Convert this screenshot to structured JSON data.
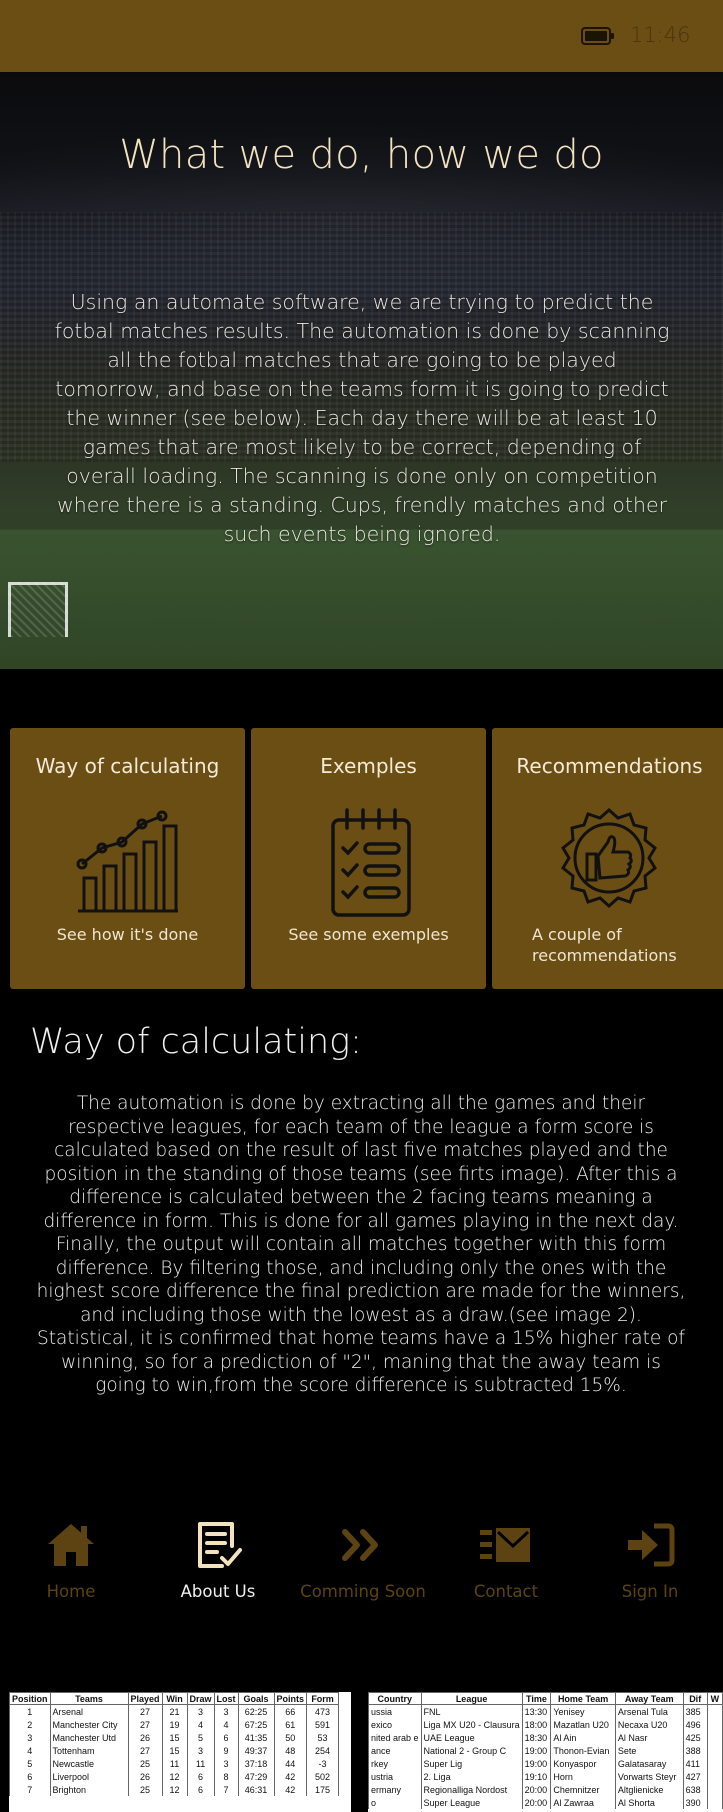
{
  "status_bar": {
    "time": "11:46"
  },
  "hero": {
    "title": "What we do, how we do",
    "text": "Using an automate software, we are trying to predict the fotbal matches results. The automation is done by scanning all the fotbal matches that are going to be played tomorrow, and base on the teams form it is going to predict the winner (see below). Each day there will be at least 10 games that are most likely to be correct, depending of overall loading. The scanning is done only on competition where there is a standing. Cups, frendly matches and other such events being ignored."
  },
  "cards": [
    {
      "title": "Way of calculating",
      "icon": "bar-chart-icon",
      "description": "See how it's done"
    },
    {
      "title": "Exemples",
      "icon": "checklist-icon",
      "description": "See some exemples"
    },
    {
      "title": "Recommendations",
      "icon": "thumbs-up-badge-icon",
      "description": "A couple of recommendations"
    }
  ],
  "calc_section": {
    "title": "Way of calculating:",
    "text": "The automation is done by extracting all the games and their respective leagues, for each team of the league a form score is calculated based on the result of last five matches played and the position in the standing of those teams (see firts image). After this a difference is calculated between the 2 facing teams meaning a difference in form. This is done for all games playing in the next day. Finally, the output will contain all matches together with this form difference. By filtering those, and including only the ones with the highest score difference the final prediction are made for the winners, and including those with the lowest as a draw.(see image 2). Statistical, it is confirmed that home teams have a 15% higher rate of winning, so for a prediction of \"2\", maning that the away team is going to win,from the score difference is subtracted 15%."
  },
  "standings_table": {
    "headers": [
      "Position",
      "Teams",
      "Played",
      "Win",
      "Draw",
      "Lost",
      "Goals",
      "Points",
      "Form"
    ],
    "rows": [
      [
        "1",
        "Arsenal",
        "27",
        "21",
        "3",
        "3",
        "62:25",
        "66",
        "473"
      ],
      [
        "2",
        "Manchester City",
        "27",
        "19",
        "4",
        "4",
        "67:25",
        "61",
        "591"
      ],
      [
        "3",
        "Manchester Utd",
        "26",
        "15",
        "5",
        "6",
        "41:35",
        "50",
        "53"
      ],
      [
        "4",
        "Tottenham",
        "27",
        "15",
        "3",
        "9",
        "49:37",
        "48",
        "254"
      ],
      [
        "5",
        "Newcastle",
        "25",
        "11",
        "11",
        "3",
        "37:18",
        "44",
        "-3"
      ],
      [
        "6",
        "Liverpool",
        "26",
        "12",
        "6",
        "8",
        "47:29",
        "42",
        "502"
      ],
      [
        "7",
        "Brighton",
        "25",
        "12",
        "6",
        "7",
        "46:31",
        "42",
        "175"
      ]
    ]
  },
  "predictions_table": {
    "headers": [
      "Country",
      "League",
      "Time",
      "Home Team",
      "Away Team",
      "Dif",
      "W"
    ],
    "rows": [
      [
        "ussia",
        "FNL",
        "13:30",
        "Yenisey",
        "Arsenal Tula",
        "385",
        ""
      ],
      [
        "exico",
        "Liga MX U20 - Clausura",
        "18:00",
        "Mazatlan U20",
        "Necaxa U20",
        "496",
        ""
      ],
      [
        "nited arab e",
        "UAE League",
        "18:30",
        "Al Ain",
        "Al Nasr",
        "425",
        ""
      ],
      [
        "ance",
        "National 2 - Group C",
        "19:00",
        "Thonon-Evian",
        "Sete",
        "388",
        ""
      ],
      [
        "rkey",
        "Super Lig",
        "19:00",
        "Konyaspor",
        "Galatasaray",
        "411",
        ""
      ],
      [
        "ustria",
        "2. Liga",
        "19:10",
        "Horn",
        "Vorwarts Steyr",
        "427",
        ""
      ],
      [
        "ermany",
        "Regionalliga Nordost",
        "20:00",
        "Chemnitzer",
        "Altglienicke",
        "638",
        ""
      ],
      [
        "o",
        "Super League",
        "20:00",
        "Al Zawraa",
        "Al Shorta",
        "390",
        ""
      ]
    ]
  },
  "nav": [
    {
      "label": "Home",
      "icon": "home-icon",
      "active": false
    },
    {
      "label": "About Us",
      "icon": "document-check-icon",
      "active": true
    },
    {
      "label": "Comming Soon",
      "icon": "double-chevron-right-icon",
      "active": false
    },
    {
      "label": "Contact",
      "icon": "envelope-icon",
      "active": false
    },
    {
      "label": "Sign In",
      "icon": "sign-in-icon",
      "active": false
    }
  ],
  "colors": {
    "accent": "#6b4e14",
    "nav_inactive": "#5c4311",
    "hero_title": "#f2e2bf"
  }
}
